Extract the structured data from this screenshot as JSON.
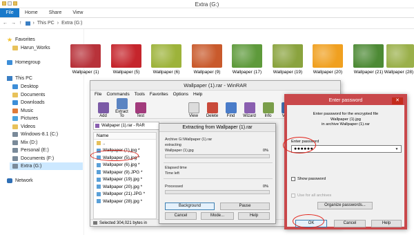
{
  "explorer": {
    "title": "Extra (G:)",
    "ribbon": {
      "file": "File",
      "tabs": [
        "Home",
        "Share",
        "View"
      ]
    },
    "address": {
      "crumbs": [
        "This PC",
        "Extra (G:)"
      ]
    },
    "nav": {
      "favorites": "Favorites",
      "fav_items": [
        "Harun_Works"
      ],
      "homegroup": "Homegroup",
      "thispc": "This PC",
      "pc_items": [
        "Desktop",
        "Documents",
        "Downloads",
        "Music",
        "Pictures",
        "Videos",
        "Windows-8.1 (C:)",
        "Mix (D:)",
        "Personal (E:)",
        "Documents (F:)",
        "Extra (G:)"
      ],
      "network": "Network"
    },
    "thumbnails": [
      {
        "label": "Wallpaper (1)",
        "color": "#b8323a"
      },
      {
        "label": "Wallpaper (5)",
        "color": "#c5252c"
      },
      {
        "label": "Wallpaper (6)",
        "color": "#9db33a"
      },
      {
        "label": "Wallpaper (9)",
        "color": "#c95a2c"
      },
      {
        "label": "Wallpaper (17)",
        "color": "#5e9a3b"
      },
      {
        "label": "Wallpaper (19)",
        "color": "#8aa33e"
      },
      {
        "label": "Wallpaper (20)",
        "color": "#f0a020"
      },
      {
        "label": "Wallpaper (21)",
        "color": "#4d8a35"
      },
      {
        "label": "Wallpaper (28)",
        "color": "#3f7f3a"
      },
      {
        "label": "",
        "color": "#9ab04a"
      }
    ]
  },
  "winrar": {
    "title": "Wallpaper (1).rar - WinRAR",
    "menu": [
      "File",
      "Commands",
      "Tools",
      "Favorites",
      "Options",
      "Help"
    ],
    "tools": [
      "Add",
      "Extract To",
      "Test",
      "View",
      "Delete",
      "Find",
      "Wizard",
      "Info",
      "Virus"
    ],
    "path": "Wallpaper (1).rar - RAR",
    "col_name": "Name",
    "files": [
      "Wallpaper (1).jpg *",
      "Wallpaper (5).jpg *",
      "Wallpaper (6).jpg *",
      "Wallpaper (9).JPG *",
      "Wallpaper (19).jpg *",
      "Wallpaper (20).jpg *",
      "Wallpaper (21).JPG *",
      "Wallpaper (28).jpg *"
    ],
    "status": "Selected 304,021 bytes in"
  },
  "extract": {
    "title": "Extracting from Wallpaper (1).rar",
    "archive_line": "Archive G:\\Wallpaper (1).rar",
    "action": "extracting",
    "current_file": "Wallpaper (1).jpg",
    "pct1": "0%",
    "elapsed": "Elapsed time",
    "timeleft": "Time left",
    "processed": "Processed",
    "pct2": "0%",
    "buttons": {
      "background": "Background",
      "pause": "Pause",
      "cancel": "Cancel",
      "mode": "Mode...",
      "help": "Help"
    }
  },
  "password": {
    "title": "Enter password",
    "close": "✕",
    "info1": "Enter password for the encrypted file",
    "info2": "Wallpaper (1).jpg",
    "info3": "in archive Wallpaper (1).rar",
    "label": "Enter password",
    "value": "●●●●●●",
    "show": "Show password",
    "useall": "Use for all archives",
    "organize": "Organize passwords...",
    "ok": "OK",
    "cancel": "Cancel",
    "help": "Help"
  },
  "colors": {
    "accent_blue": "#1979ca",
    "highlight_red": "#e2231a",
    "dialog_border": "#c9484b"
  }
}
